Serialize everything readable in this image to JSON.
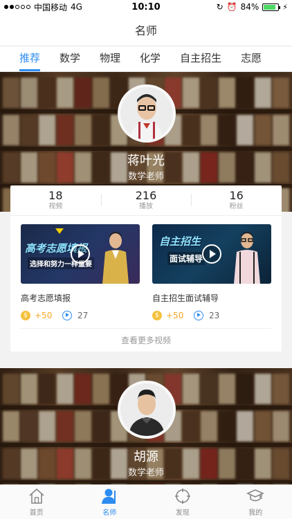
{
  "status_bar": {
    "carrier": "中国移动",
    "network": "4G",
    "time": "10:10",
    "battery": "84%",
    "battery_level": 0.84
  },
  "header": {
    "title": "名师"
  },
  "tabs": [
    {
      "label": "推荐",
      "active": true
    },
    {
      "label": "数学"
    },
    {
      "label": "物理"
    },
    {
      "label": "化学"
    },
    {
      "label": "自主招生"
    },
    {
      "label": "志愿"
    }
  ],
  "teachers": [
    {
      "name": "蒋叶光",
      "title": "数学老师",
      "stats": [
        {
          "value": "18",
          "label": "视频"
        },
        {
          "value": "216",
          "label": "播放"
        },
        {
          "value": "16",
          "label": "粉丝"
        }
      ],
      "videos": [
        {
          "title": "高考志愿填报",
          "thumb_title": "高考志愿填报",
          "thumb_sub": "选择和努力一样重要",
          "coins": "+50",
          "plays": "27"
        },
        {
          "title": "自主招生面试辅导",
          "thumb_title": "自主招生",
          "thumb_sub": "面试辅导",
          "coins": "+50",
          "plays": "23"
        }
      ],
      "more_label": "查看更多视频"
    },
    {
      "name": "胡源",
      "title": "数学老师"
    }
  ],
  "tab_bar": [
    {
      "label": "首页",
      "icon": "home-icon"
    },
    {
      "label": "名师",
      "icon": "teacher-icon",
      "active": true
    },
    {
      "label": "发现",
      "icon": "discover-icon"
    },
    {
      "label": "我的",
      "icon": "profile-icon"
    }
  ],
  "colors": {
    "accent": "#2d8cf0",
    "coin": "#f5a623"
  }
}
